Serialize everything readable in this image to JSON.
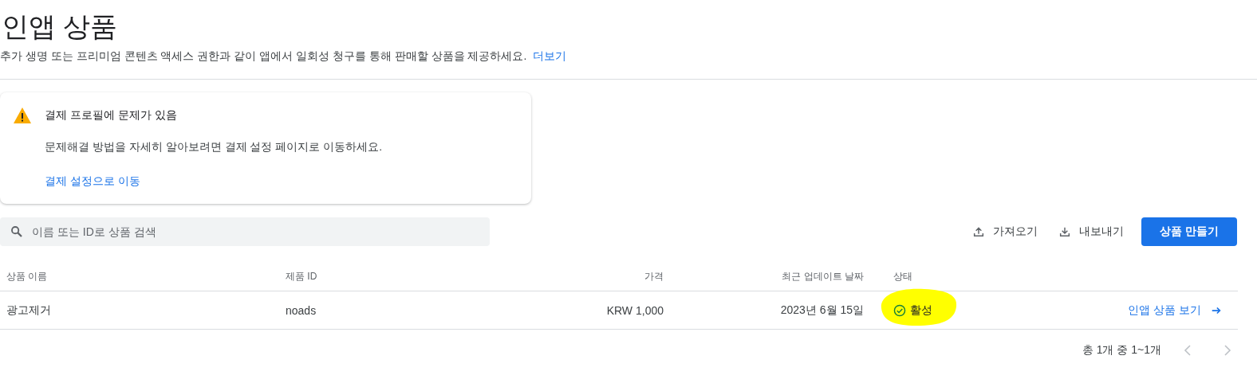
{
  "header": {
    "title": "인앱 상품",
    "description": "추가 생명 또는 프리미엄 콘텐츠 액세스 권한과 같이 앱에서 일회성 청구를 통해 판매할 상품을 제공하세요.",
    "learn_more": "더보기"
  },
  "alert": {
    "kind": "warning",
    "title": "결제 프로필에 문제가 있음",
    "message": "문제해결 방법을 자세히 알아보려면 결제 설정 페이지로 이동하세요.",
    "link": "결제 설정으로 이동"
  },
  "toolbar": {
    "search": {
      "placeholder": "이름 또는 ID로 상품 검색"
    },
    "import": "가져오기",
    "export": "내보내기",
    "create": "상품 만들기"
  },
  "table": {
    "columns": [
      "상품 이름",
      "제품 ID",
      "가격",
      "최근 업데이트 날짜",
      "상태"
    ],
    "rows": [
      {
        "name": "광고제거",
        "product_id": "noads",
        "price": "KRW 1,000",
        "updated": "2023년 6월 15일",
        "status": {
          "kind": "active",
          "label": "활성"
        },
        "highlighted": true,
        "link": "인앱 상품 보기"
      }
    ]
  },
  "pagination": {
    "summary": "총 1개 중 1~1개",
    "prev_disabled": true,
    "next_disabled": true
  }
}
